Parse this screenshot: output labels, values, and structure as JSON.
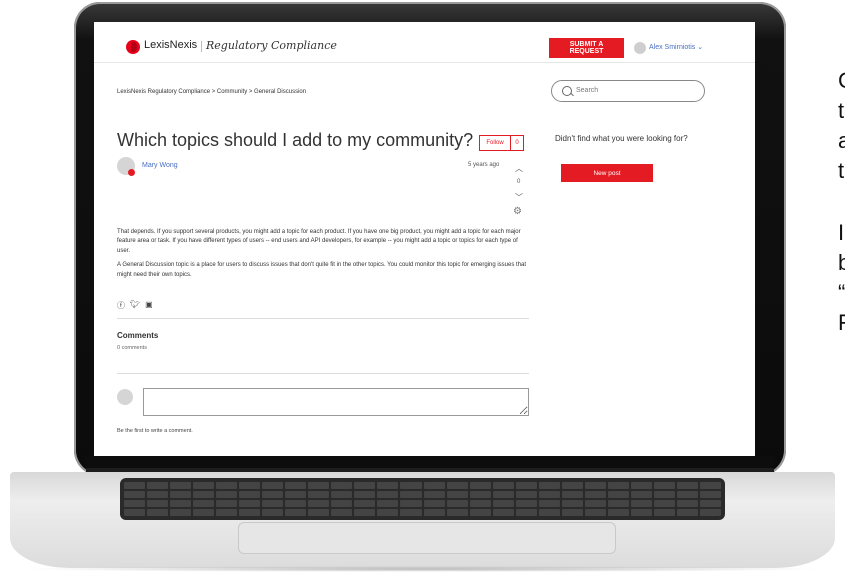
{
  "header": {
    "logo": "LexisNexis",
    "logo_sub": "Regulatory Compliance",
    "request_button": "SUBMIT A REQUEST",
    "user": "Alex Smirniotis ⌄"
  },
  "breadcrumb": "LexisNexis Regulatory Compliance > Community > General Discussion",
  "search": {
    "placeholder": "Search"
  },
  "post": {
    "title": "Which topics should I add to my community?",
    "follow_label": "Follow",
    "follow_count": "0",
    "author": "Mary Wong",
    "time_ago": "5 years ago",
    "votes": "0",
    "body": [
      "That depends. If you support several products, you might add a topic for each product. If you have one big product, you might add a topic for each major feature area or task. If you have different types of users -- end users and API developers, for example -- you might add a topic or topics for each type of user.",
      "A General Discussion topic is a place for users to discuss issues that don't quite fit in the other topics. You could monitor this topic for emerging issues that might need their own topics."
    ],
    "share_icons": [
      "facebook-icon",
      "twitter-icon",
      "linkedin-icon"
    ]
  },
  "comments": {
    "title": "Comments",
    "count": "0 comments",
    "first_prompt": "Be the first to write a comment."
  },
  "sidebar": {
    "question": "Didn't find what you were looking for?",
    "new_post": "New post"
  },
  "side_text": [
    "C",
    "t",
    "a",
    "t",
    "I",
    "b",
    "“",
    "F"
  ],
  "colors": {
    "brand_red": "#e41b23",
    "link_blue": "#4a6fc4"
  }
}
